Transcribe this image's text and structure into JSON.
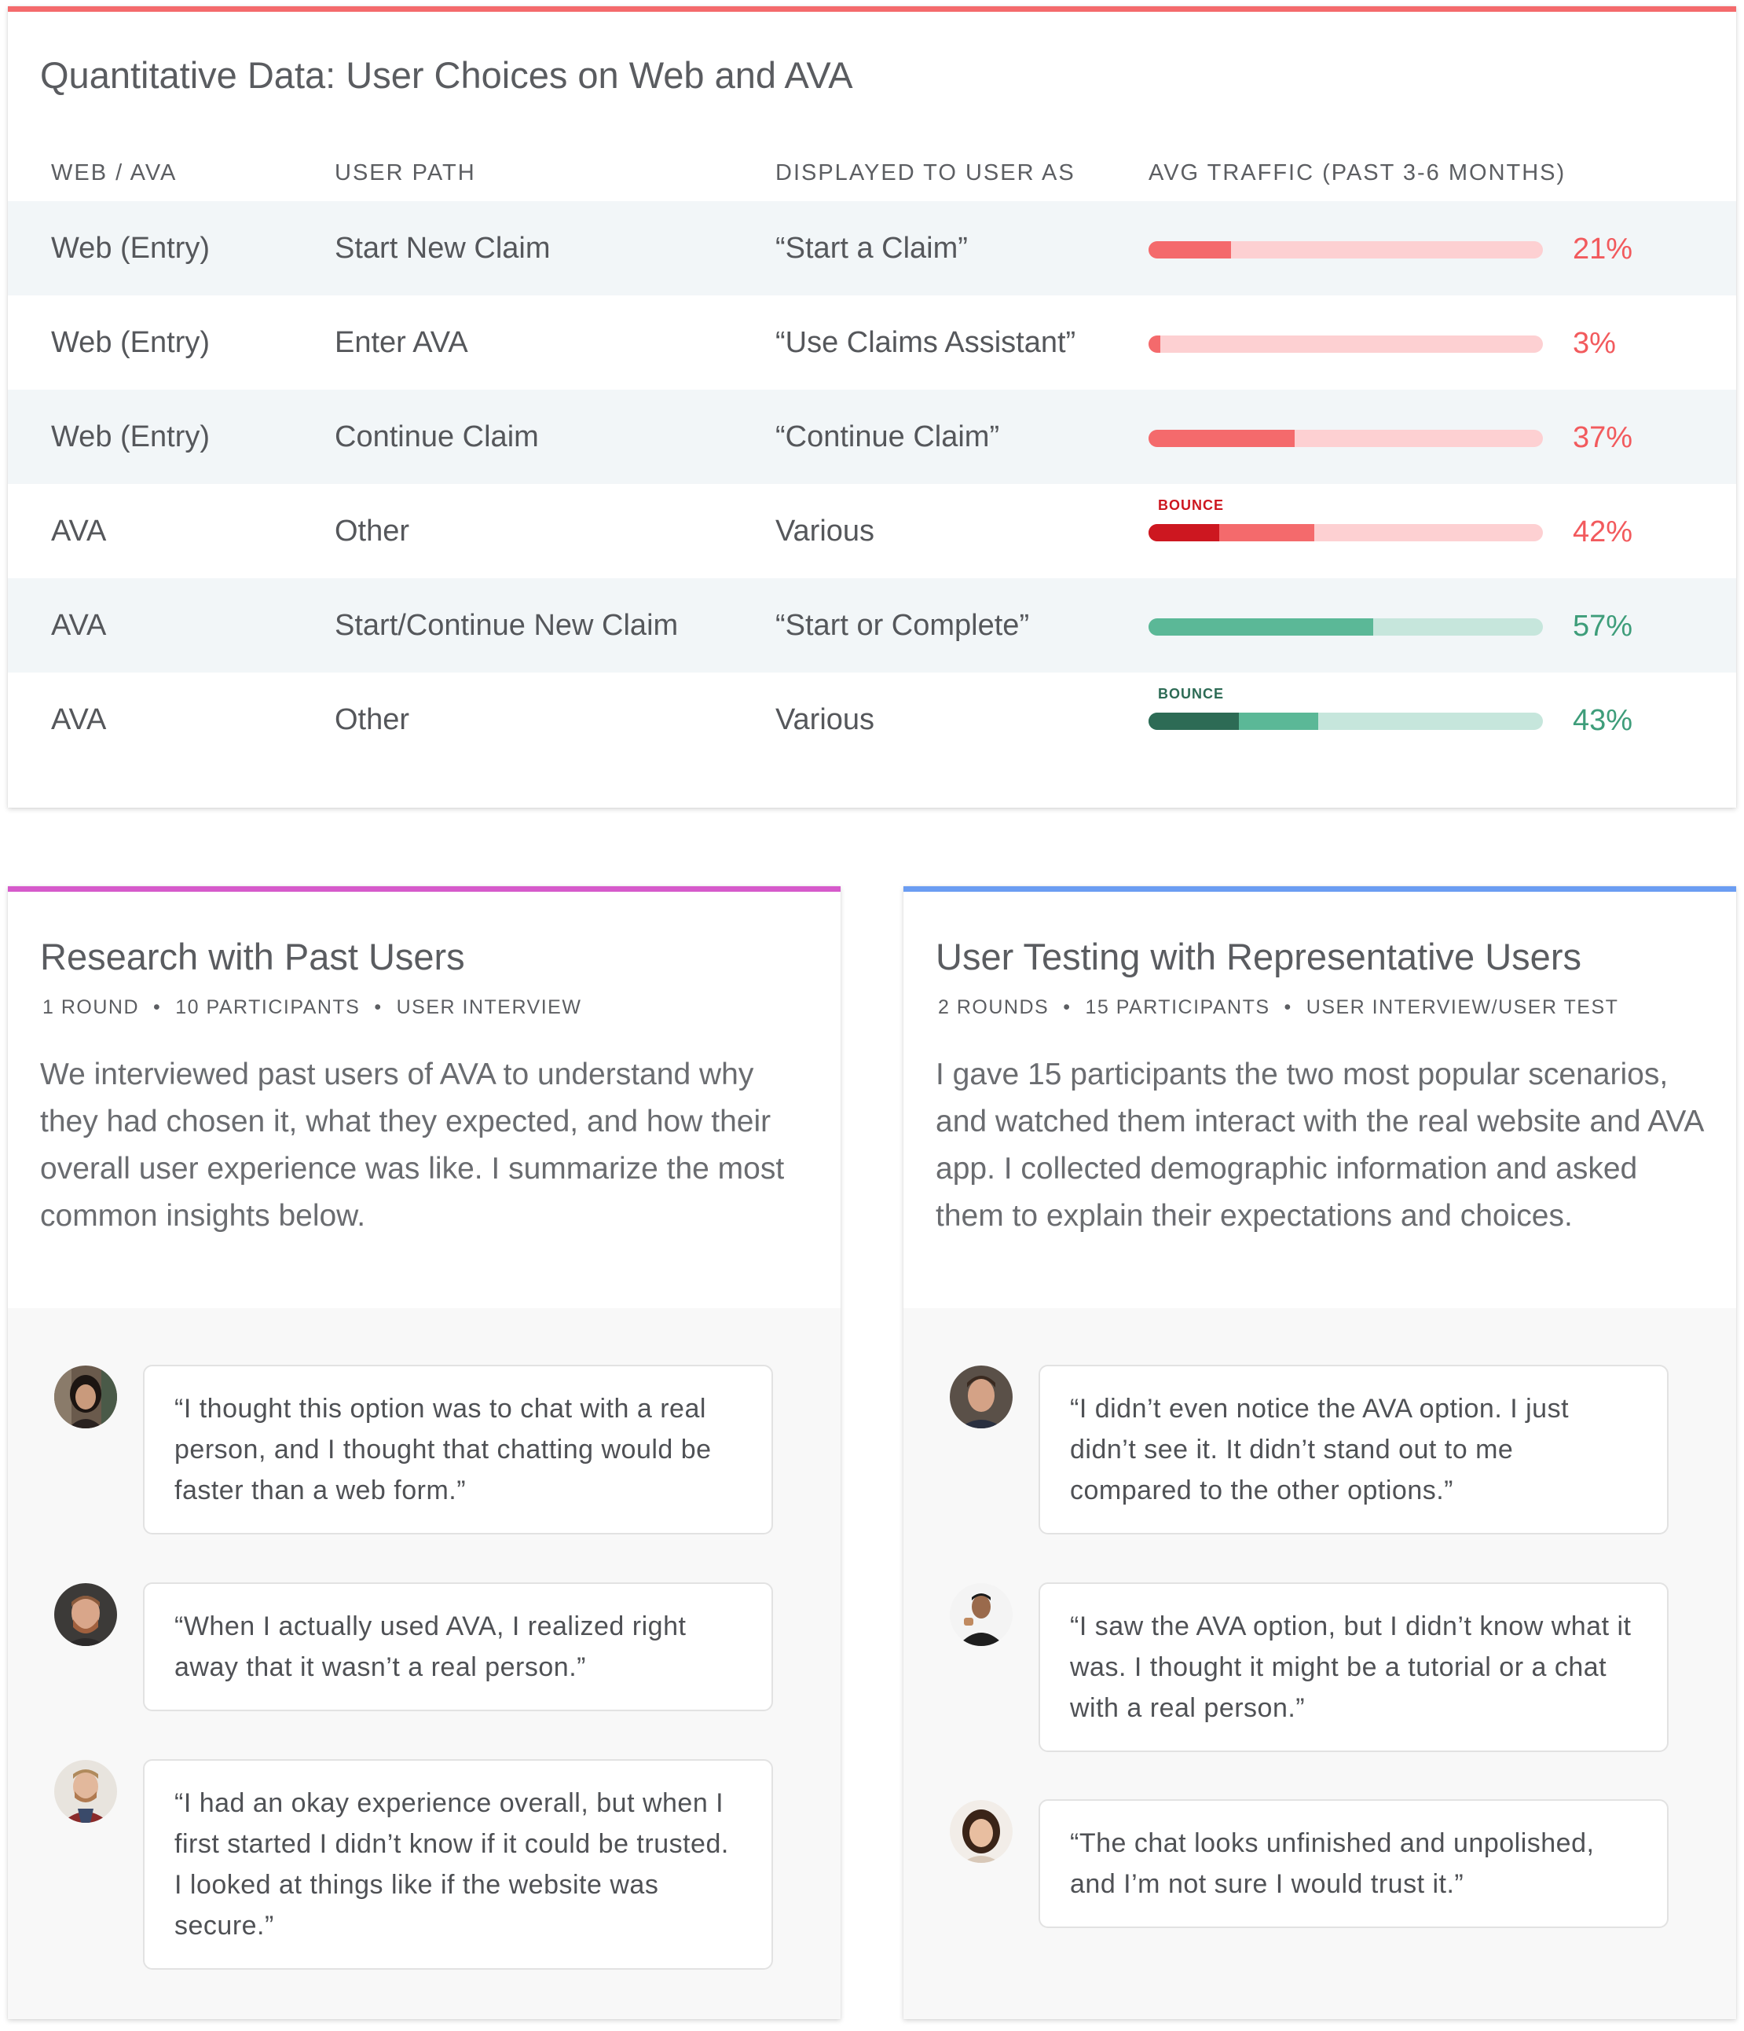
{
  "quant": {
    "title": "Quantitative Data: User Choices on Web and AVA",
    "headers": [
      "WEB / AVA",
      "USER PATH",
      "DISPLAYED TO USER AS",
      "AVG TRAFFIC (PAST 3-6 MONTHS)"
    ],
    "rows": [
      {
        "channel": "Web (Entry)",
        "path": "Start New Claim",
        "display": "“Start a Claim”",
        "pct": "21%",
        "value": 0.21,
        "bounce": null
      },
      {
        "channel": "Web (Entry)",
        "path": "Enter AVA",
        "display": "“Use Claims Assistant”",
        "pct": "3%",
        "value": 0.03,
        "bounce": null
      },
      {
        "channel": "Web (Entry)",
        "path": "Continue Claim",
        "display": "“Continue Claim”",
        "pct": "37%",
        "value": 0.37,
        "bounce": null
      },
      {
        "channel": "AVA",
        "path": "Other",
        "display": "Various",
        "pct": "42%",
        "value": 0.42,
        "bounce": 0.18,
        "bounce_label": "BOUNCE"
      },
      {
        "channel": "AVA",
        "path": "Start/Continue New Claim",
        "display": "“Start or Complete”",
        "pct": "57%",
        "value": 0.57,
        "bounce": null
      },
      {
        "channel": "AVA",
        "path": "Other",
        "display": "Various",
        "pct": "43%",
        "value": 0.43,
        "bounce": 0.23,
        "bounce_label": "BOUNCE"
      }
    ],
    "colors": {
      "red": {
        "track": "#fdd0d2",
        "fill": "#f46a6c",
        "bounce": "#cd1720",
        "text": "#f25a5d"
      },
      "green": {
        "track": "#c6e6dc",
        "fill": "#5bb897",
        "bounce": "#2d6b55",
        "text": "#3e9d7a"
      }
    },
    "row_color": [
      "red",
      "red",
      "red",
      "red",
      "green",
      "green"
    ]
  },
  "past": {
    "title": "Research with Past Users",
    "meta": [
      "1 ROUND",
      "10 PARTICIPANTS",
      "USER INTERVIEW"
    ],
    "description": "We interviewed past users of AVA to understand why they had chosen it, what they expected, and how their overall user experience was like. I summarize the most common insights below.",
    "quotes": [
      "“I thought this option was to chat with a real person, and I thought that chatting would be faster than a web form.”",
      "“When I actually used AVA, I realized right away that it wasn’t a real person.”",
      "“I had an okay experience overall, but when I first started I didn’t know if it could be trusted. I looked at things like if the website was secure.”"
    ]
  },
  "testing": {
    "title": "User Testing with Representative Users",
    "meta": [
      "2 ROUNDS",
      "15 PARTICIPANTS",
      "USER INTERVIEW/USER TEST"
    ],
    "description": "I gave 15 participants the two most popular scenarios, and watched them interact with the real website and AVA app. I collected demographic information and asked them to explain their expectations and choices.",
    "quotes": [
      "“I didn’t even notice the AVA option. I just didn’t see it. It didn’t stand out to me compared to the other options.”",
      "“I saw the AVA option, but I didn’t know what it was. I thought it might be a tutorial or a chat with a real person.”",
      "“The chat looks unfinished and unpolished, and I’m not sure I would trust it.”"
    ]
  },
  "meta_separator": "•"
}
